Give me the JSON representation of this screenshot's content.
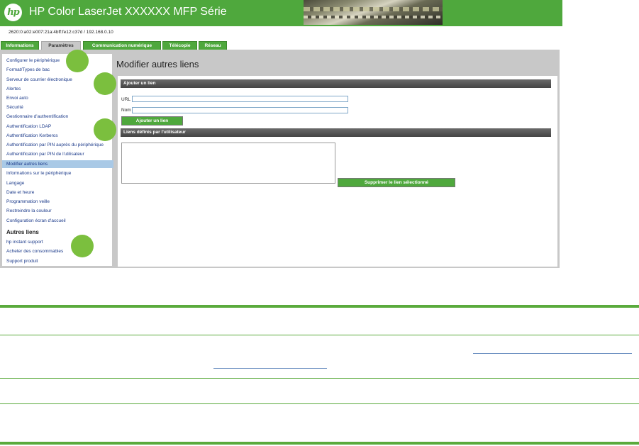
{
  "header": {
    "logo_text": "hp",
    "title": "HP Color LaserJet XXXXXX MFP Série"
  },
  "address": "2620:0:a02:e007:21a:4bff:fe12:c37d / 192.168.0.10",
  "tabs": [
    {
      "label": "Informations",
      "active": false
    },
    {
      "label": "Paramètres",
      "active": true
    },
    {
      "label": "Communication numérique",
      "active": false
    },
    {
      "label": "Télécopie",
      "active": false
    },
    {
      "label": "Réseau",
      "active": false
    }
  ],
  "sidebar": {
    "items": [
      {
        "label": "Configurer le périphérique"
      },
      {
        "label": "Format/Types de bac"
      },
      {
        "label": "Serveur de courrier électronique"
      },
      {
        "label": "Alertes"
      },
      {
        "label": "Envoi auto"
      },
      {
        "label": "Sécurité"
      },
      {
        "label": "Gestionnaire d'authentification"
      },
      {
        "label": "Authentification LDAP"
      },
      {
        "label": "Authentification Kerberos"
      },
      {
        "label": "Authentification par PIN auprès du périphérique"
      },
      {
        "label": "Authentification par PIN de l'utilisateur"
      },
      {
        "label": "Modifier autres liens",
        "selected": true
      },
      {
        "label": "Informations sur le périphérique"
      },
      {
        "label": "Langage"
      },
      {
        "label": "Date et heure"
      },
      {
        "label": "Programmation veille"
      },
      {
        "label": "Restreindre la couleur"
      },
      {
        "label": "Configuration écran d'accueil"
      }
    ],
    "other_links_heading": "Autres liens",
    "other_links": [
      {
        "label": "hp instant support"
      },
      {
        "label": "Acheter des consommables"
      },
      {
        "label": "Support produit"
      }
    ]
  },
  "main": {
    "page_title": "Modifier autres liens",
    "add_section": {
      "heading": "Ajouter un lien",
      "url_label": "URL",
      "url_value": "",
      "name_label": "Nom",
      "name_value": "",
      "add_button": "Ajouter un lien"
    },
    "user_section": {
      "heading": "Liens définis par l'utilisateur",
      "delete_button": "Supprimer le lien sélectionné"
    }
  },
  "colors": {
    "brand_green": "#4fa83d",
    "panel_gray": "#c8c8c8",
    "selected_item": "#a9c9e6",
    "marker_green": "#7bbf3e"
  }
}
